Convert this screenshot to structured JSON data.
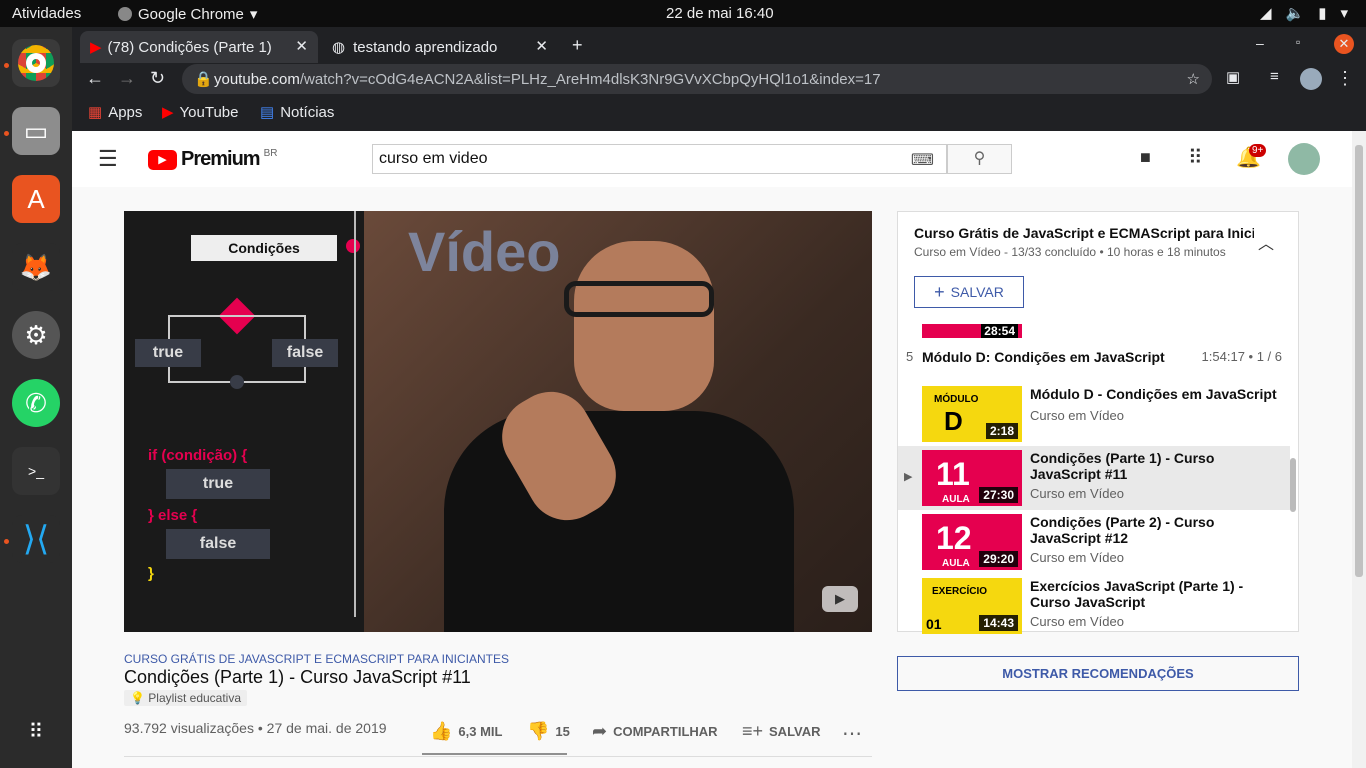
{
  "topbar": {
    "activities": "Atividades",
    "app": "Google Chrome",
    "clock": "22 de mai  16:40"
  },
  "tabs": [
    {
      "label": "(78) Condições (Parte 1)"
    },
    {
      "label": "testando aprendizado"
    }
  ],
  "omnibox": {
    "host": "youtube.com",
    "path": "/watch?v=cOdG4eACN2A&list=PLHz_AreHm4dlsK3Nr9GVvXCbpQyHQl1o1&index=17"
  },
  "bookmarks": [
    "Apps",
    "YouTube",
    "Notícias"
  ],
  "yt": {
    "logo": "Premium",
    "region": "BR",
    "search": "curso em video",
    "notifications": "9+"
  },
  "video": {
    "box_title": "Condições",
    "true_label": "true",
    "false_label": "false",
    "code_if": "if (condição) {",
    "code_true": "true",
    "code_else": "} else {",
    "code_false": "false",
    "code_end": "}",
    "brand": "Vídeo"
  },
  "meta": {
    "playlist": "CURSO GRÁTIS DE JAVASCRIPT E ECMASCRIPT PARA INICIANTES",
    "title": "Condições (Parte 1) - Curso JavaScript #11",
    "badge": "Playlist educativa",
    "views": "93.792 visualizações • 27 de mai. de 2019",
    "likes": "6,3 MIL",
    "dislikes": "15",
    "share": "COMPARTILHAR",
    "save": "SALVAR"
  },
  "panel": {
    "title": "Curso Grátis de JavaScript e ECMAScript para Inician",
    "sub": "Curso em Vídeo - 13/33 concluído • 10 horas e 18 minutos",
    "save": "SALVAR",
    "section_num": "5",
    "section": "Módulo D: Condições em JavaScript",
    "section_meta": "1:54:17 • 1 / 6",
    "prev_dur": "28:54"
  },
  "items": [
    {
      "title": "Módulo D - Condições em JavaScript",
      "channel": "Curso em Vídeo",
      "dur": "2:18",
      "big": "D",
      "tag": "MÓDULO"
    },
    {
      "title": "Condições (Parte 1) - Curso JavaScript #11",
      "channel": "Curso em Vídeo",
      "dur": "27:30",
      "big": "11",
      "tag": "AULA"
    },
    {
      "title": "Condições (Parte 2) - Curso JavaScript #12",
      "channel": "Curso em Vídeo",
      "dur": "29:20",
      "big": "12",
      "tag": "AULA"
    },
    {
      "title": "Exercícios JavaScript (Parte 1) - Curso JavaScript",
      "channel": "Curso em Vídeo",
      "dur": "14:43",
      "big": "01",
      "tag": "EXERCÍCIO"
    }
  ],
  "recommend": "MOSTRAR RECOMENDAÇÕES",
  "colors": {
    "accent": "#3e5aa8",
    "yt_red": "#ff0000",
    "pink": "#e5004f",
    "yellow": "#f5d80f"
  }
}
